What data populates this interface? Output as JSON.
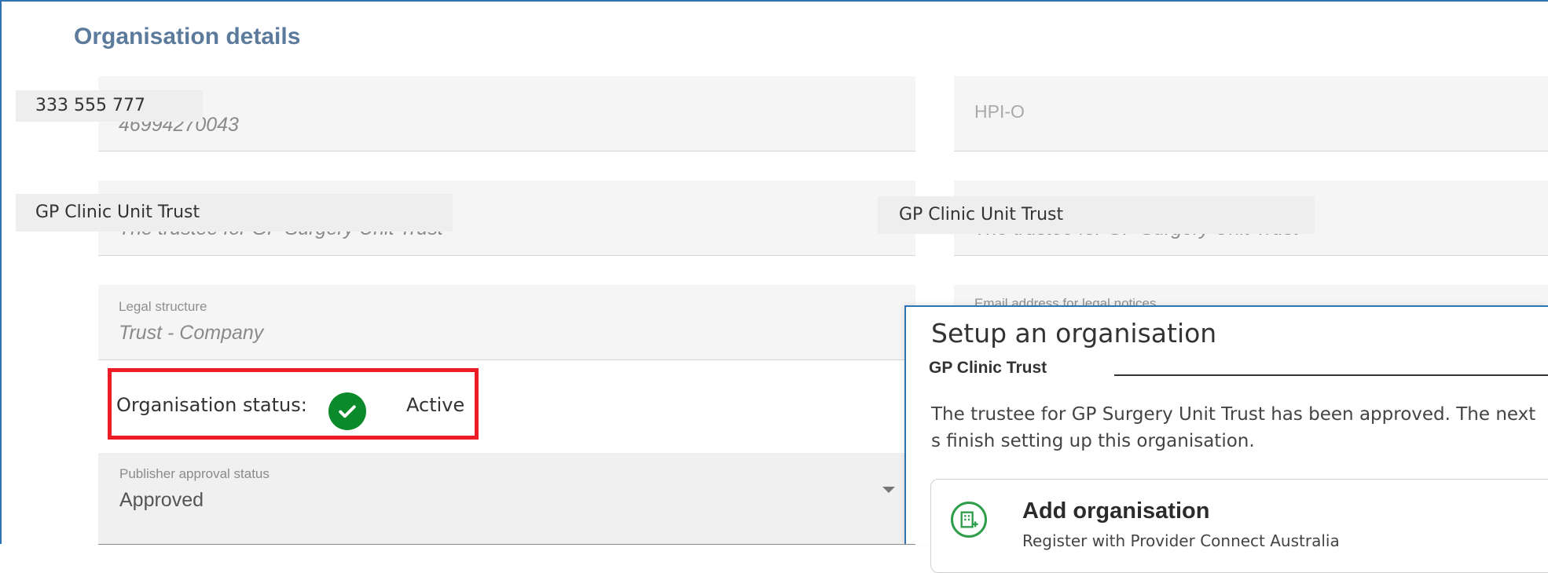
{
  "section": {
    "title": "Organisation details"
  },
  "fields": {
    "abn_value": "46994270043",
    "hpio_placeholder": "HPI-O",
    "org_name_value": "The trustee for GP Surgery Unit Trust",
    "trading_name_value": "The trustee for GP Surgery Unit Trust",
    "legal_structure_label": "Legal structure",
    "legal_structure_value": "Trust - Company",
    "email_label": "Email address for legal notices",
    "publisher_label": "Publisher approval status",
    "publisher_value": "Approved"
  },
  "overlays": {
    "abn_overlay": "333 555 777",
    "org_name_overlay": "GP Clinic Unit Trust",
    "trading_name_overlay": "GP Clinic Unit Trust"
  },
  "status": {
    "label": "Organisation status:",
    "value": "Active",
    "icon": "check-circle-icon",
    "color": "#0b8a2b",
    "highlight_color": "#ee1c24"
  },
  "dialog": {
    "title": "Setup an organisation",
    "subtitle": "GP Clinic Trust",
    "message": "The trustee for GP Surgery Unit Trust has been approved. The next s finish setting up this organisation.",
    "card": {
      "icon": "building-add-icon",
      "title": "Add organisation",
      "description": "Register with Provider Connect Australia"
    }
  }
}
